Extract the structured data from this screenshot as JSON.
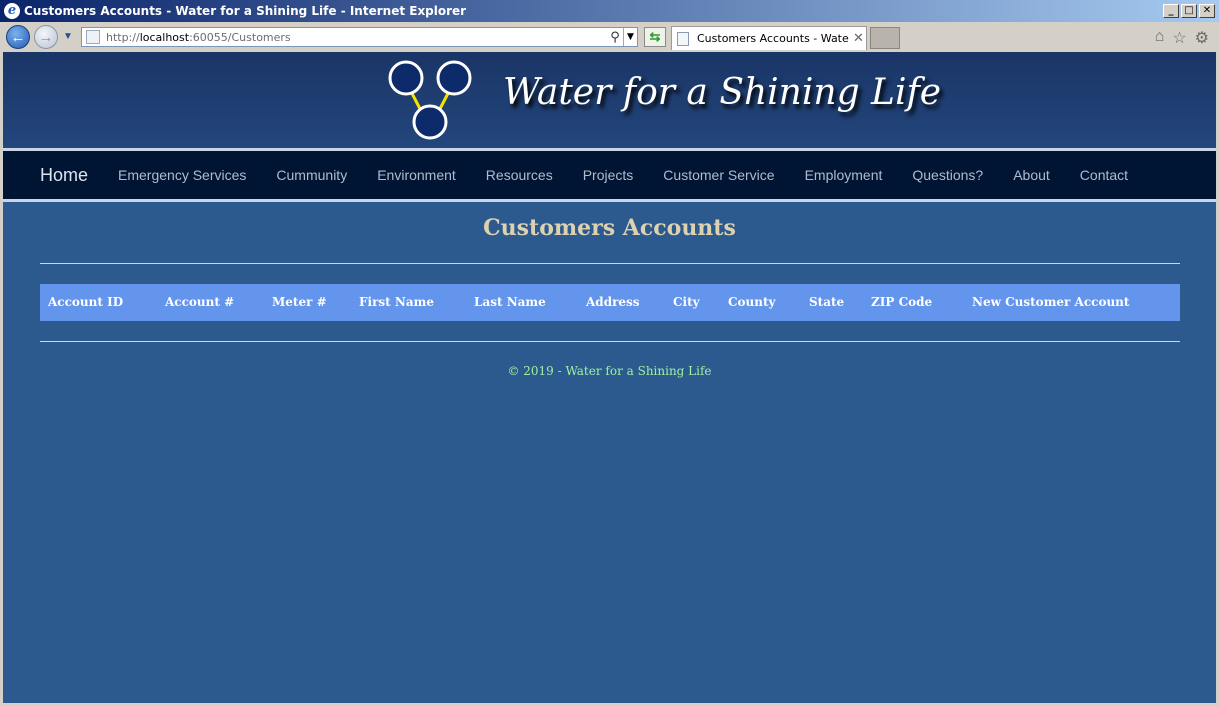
{
  "window": {
    "title": "Customers Accounts - Water for a Shining Life - Internet Explorer",
    "controls": [
      "_",
      "□",
      "✕"
    ]
  },
  "browser": {
    "url_prefix": "http://",
    "url_host": "localhost",
    "url_rest": ":60055/Customers",
    "tab_label": "Customers Accounts - Water...",
    "tab_close": "✕",
    "icons": [
      "home-icon",
      "star-icon",
      "gear-icon"
    ]
  },
  "site": {
    "title": "Water for a Shining Life",
    "nav": [
      "Home",
      "Emergency Services",
      "Cummunity",
      "Environment",
      "Resources",
      "Projects",
      "Customer Service",
      "Employment",
      "Questions?",
      "About",
      "Contact"
    ]
  },
  "page": {
    "heading": "Customers Accounts",
    "table_headers": [
      "Account ID",
      "Account #",
      "Meter #",
      "First Name",
      "Last Name",
      "Address",
      "City",
      "County",
      "State",
      "ZIP Code",
      "New Customer Account"
    ],
    "footer": "© 2019 - Water for a Shining Life"
  },
  "colors": {
    "banner": "#1a3566",
    "nav_bg": "#001433",
    "page_bg": "#2d5a8e",
    "table_header_bg": "#6495ed",
    "heading_color": "#dcd2b0",
    "footer_color": "#9ff0a0"
  }
}
